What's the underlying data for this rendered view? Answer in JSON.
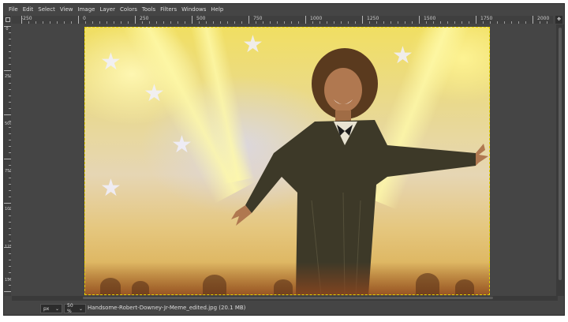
{
  "menu": [
    "File",
    "Edit",
    "Select",
    "View",
    "Image",
    "Layer",
    "Colors",
    "Tools",
    "Filters",
    "Windows",
    "Help"
  ],
  "ruler": {
    "h_labels": [
      "-250",
      "0",
      "250",
      "500",
      "750",
      "1000",
      "1250",
      "1500",
      "1750",
      "2000"
    ],
    "v_labels": [
      "0",
      "250",
      "500",
      "750",
      "1000",
      "1250",
      "1500"
    ]
  },
  "status": {
    "unit": "px",
    "zoom": "50 %",
    "file_info": "Handsome-Robert-Downey-Jr-Meme_edited.jpg (20.1 MB)"
  },
  "icons": {
    "navigate": "navigate-icon",
    "chevron": "chevron-down-icon"
  },
  "colors": {
    "ui_bg": "#454545",
    "selection": "#e8d300"
  }
}
